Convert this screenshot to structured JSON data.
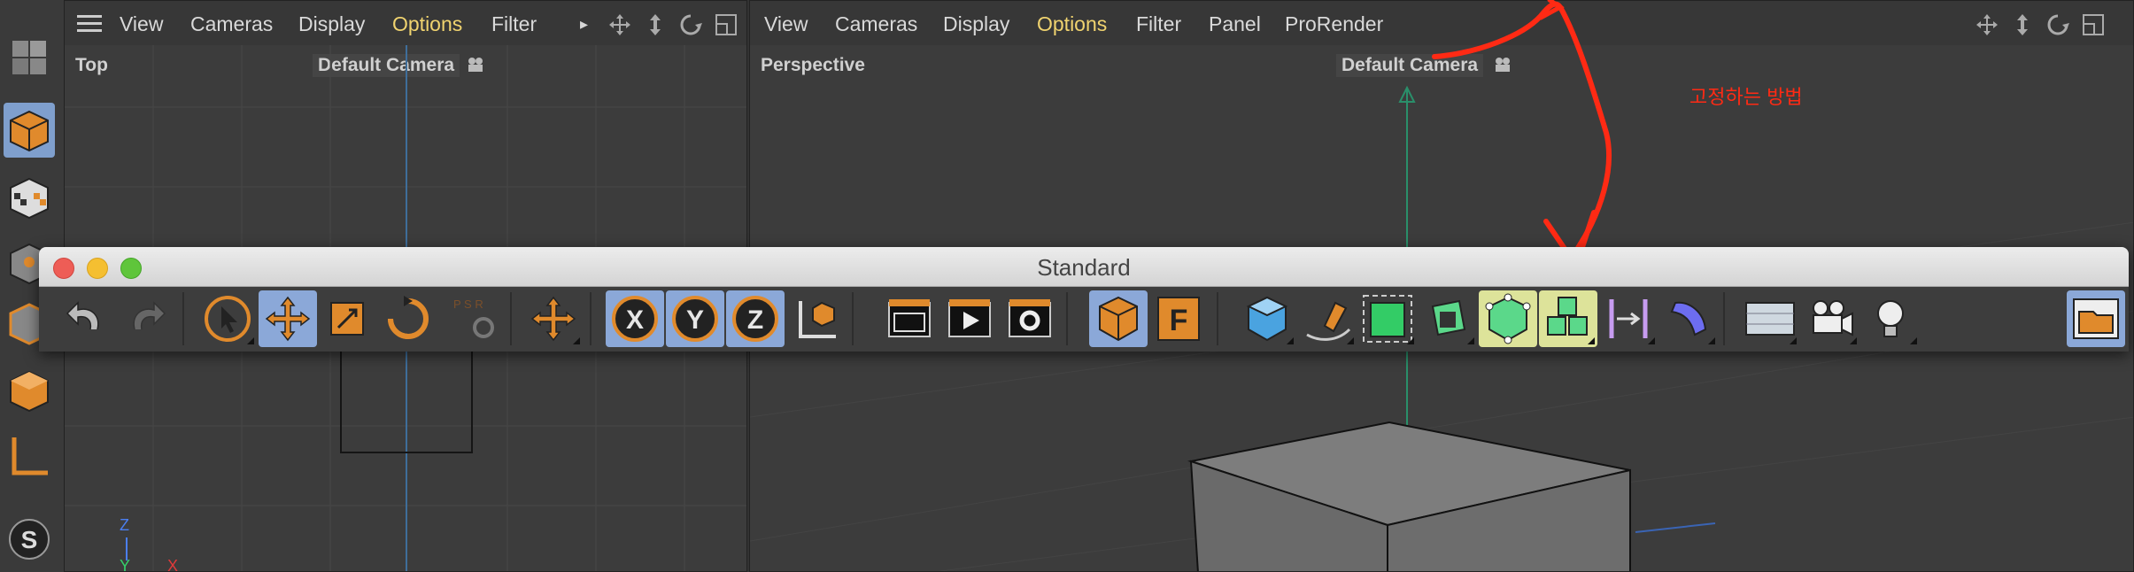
{
  "left_viewport": {
    "menu": [
      "View",
      "Cameras",
      "Display",
      "Options",
      "Filter"
    ],
    "highlighted_menu": "Options",
    "view_label": "Top",
    "camera_label": "Default Camera",
    "axis_z": "Z",
    "axis_y": "Y",
    "axis_x": "X"
  },
  "right_viewport": {
    "menu": [
      "View",
      "Cameras",
      "Display",
      "Options",
      "Filter",
      "Panel",
      "ProRender"
    ],
    "highlighted_menu": "Options",
    "view_label": "Perspective",
    "camera_label": "Default Camera"
  },
  "standard_window": {
    "title": "Standard",
    "psr_label": "P S R"
  },
  "annotation": {
    "text": "고정하는 방법",
    "color": "#ff2a14"
  },
  "colors": {
    "accent_orange": "#e08a2c",
    "active_blue": "#8ba8d8",
    "highlight_yellow": "#dde39a",
    "menu_highlight": "#f0d36f"
  },
  "icons": {
    "left_toolbar": [
      "grid-blocks-icon",
      "cube-model-icon",
      "checker-cube-icon",
      "point-cube-icon",
      "edge-cube-icon",
      "polygon-cube-icon",
      "axis-icon",
      "snap-icon"
    ],
    "standard_toolbar": [
      "undo-icon",
      "redo-icon",
      "select-icon",
      "move-icon",
      "scale-icon",
      "rotate-icon",
      "psr-icon",
      "world-move-icon",
      "x-axis-icon",
      "y-axis-icon",
      "z-axis-icon",
      "coordinate-system-icon",
      "render-view-icon",
      "render-picture-icon",
      "render-settings-icon",
      "model-mode-icon",
      "floor-f-icon",
      "cube-primitive-icon",
      "pen-spline-icon",
      "subdivision-icon",
      "extrude-icon",
      "mograph-cloner-icon",
      "array-cubes-icon",
      "deformer-icon",
      "field-icon",
      "floor-icon",
      "camera-icon",
      "light-icon",
      "content-browser-icon"
    ]
  }
}
